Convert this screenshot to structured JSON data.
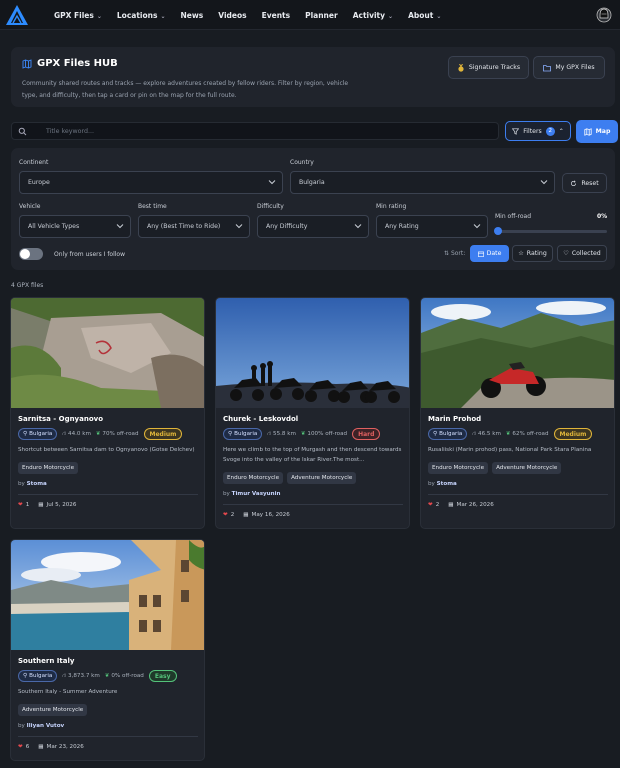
{
  "nav": {
    "items": [
      {
        "label": "GPX Files",
        "dropdown": true
      },
      {
        "label": "Locations",
        "dropdown": true
      },
      {
        "label": "News",
        "dropdown": false
      },
      {
        "label": "Videos",
        "dropdown": false
      },
      {
        "label": "Events",
        "dropdown": false
      },
      {
        "label": "Planner",
        "dropdown": false
      },
      {
        "label": "Activity",
        "dropdown": true
      },
      {
        "label": "About",
        "dropdown": true
      }
    ]
  },
  "hub": {
    "title": "GPX Files HUB",
    "description": "Community shared routes and tracks — explore adventures created by fellow riders. Filter by region, vehicle type, and difficulty, then tap a card or pin on the map for the full route.",
    "signature_label": "Signature Tracks",
    "my_files_label": "My GPX Files"
  },
  "search": {
    "placeholder": "Title keyword...",
    "value": ""
  },
  "toolbar": {
    "filters_label": "Filters",
    "filters_count": "2",
    "map_label": "Map"
  },
  "filters": {
    "continent_label": "Continent",
    "continent_value": "Europe",
    "country_label": "Country",
    "country_value": "Bulgaria",
    "reset_label": "Reset",
    "vehicle_label": "Vehicle",
    "vehicle_value": "All Vehicle Types",
    "best_time_label": "Best time",
    "best_time_value": "Any (Best Time to Ride)",
    "difficulty_label": "Difficulty",
    "difficulty_value": "Any Difficulty",
    "rating_label": "Min rating",
    "rating_value": "Any Rating",
    "offroad_label": "Min off-road",
    "offroad_value": "0%",
    "offroad_level": 0,
    "follow_label": "Only from users I follow",
    "follow_on": false,
    "sort_label": "Sort:",
    "sort_date": "Date",
    "sort_rating": "Rating",
    "sort_collected": "Collected"
  },
  "results": {
    "count": "4 GPX files"
  },
  "cards": [
    {
      "title": "Sarnitsa - Ognyanovo",
      "country": "Bulgaria",
      "distance": "44.0 km",
      "offroad": "70% off-road",
      "difficulty": "Medium",
      "description": "Shortcut between Sarnitsa dam to Ognyanovo (Gotse Delchev)",
      "tags": [
        "Enduro Motorcycle"
      ],
      "by": "by",
      "author": "Stoma",
      "likes": "1",
      "date": "Jul 5, 2026"
    },
    {
      "title": "Churek - Leskovdol",
      "country": "Bulgaria",
      "distance": "55.8 km",
      "offroad": "100% off-road",
      "difficulty": "Hard",
      "description": "Here we climb to the top of Murgash and then descend towards Svoge into the valley of the Iskar River.The most...",
      "tags": [
        "Enduro Motorcycle",
        "Adventure Motorcycle"
      ],
      "by": "by",
      "author": "Timur Vasyunin",
      "likes": "2",
      "date": "May 16, 2026"
    },
    {
      "title": "Marin Prohod",
      "country": "Bulgaria",
      "distance": "46.5 km",
      "offroad": "62% off-road",
      "difficulty": "Medium",
      "description": "Rusaliiski (Marin prohod) pass, National Park Stara Planina",
      "tags": [
        "Enduro Motorcycle",
        "Adventure Motorcycle"
      ],
      "by": "by",
      "author": "Stoma",
      "likes": "2",
      "date": "Mar 26, 2026"
    },
    {
      "title": "Southern Italy",
      "country": "Bulgaria",
      "distance": "3,873.7 km",
      "offroad": "0% off-road",
      "difficulty": "Easy",
      "description": "Southern Italy - Summer Adventure",
      "tags": [
        "Adventure Motorcycle"
      ],
      "by": "by",
      "author": "Iliyan Vutov",
      "likes": "6",
      "date": "Mar 23, 2026"
    }
  ],
  "colors": {
    "accent": "#3d7ef0",
    "medium": "#e0b53a",
    "hard": "#e06060",
    "easy": "#54c27a",
    "heart": "#e5484d"
  }
}
